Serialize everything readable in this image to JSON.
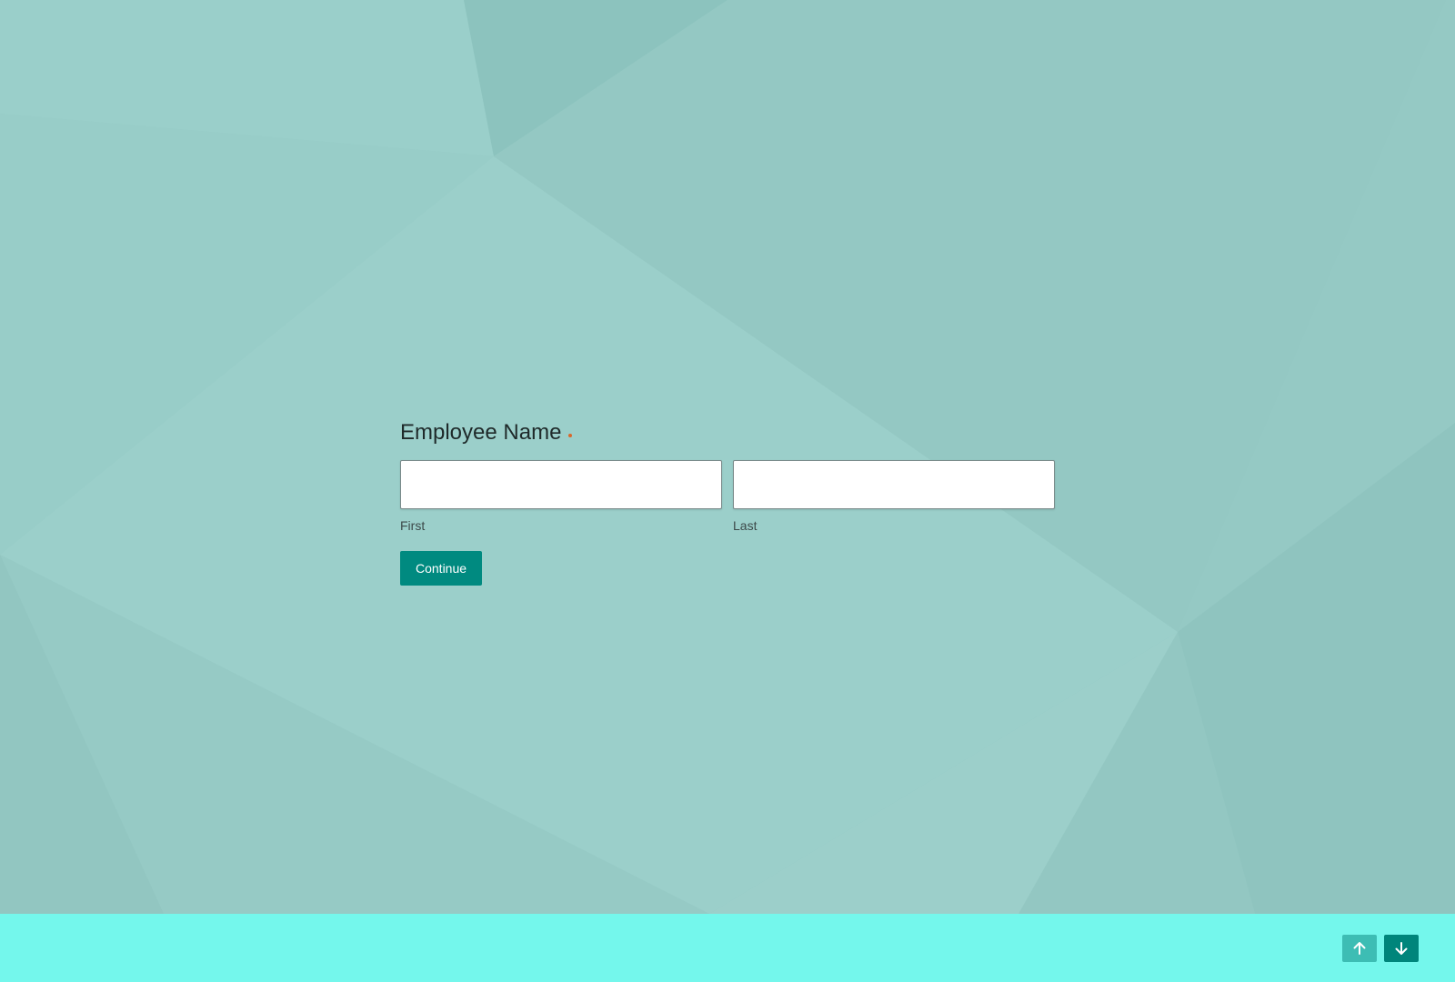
{
  "question": {
    "label": "Employee Name",
    "required": true
  },
  "fields": {
    "first": {
      "value": "",
      "sublabel": "First"
    },
    "last": {
      "value": "",
      "sublabel": "Last"
    }
  },
  "actions": {
    "continue_label": "Continue"
  },
  "footer_nav": {
    "up_icon": "arrow-up-icon",
    "down_icon": "arrow-down-icon"
  },
  "colors": {
    "background": "#96c9c4",
    "footer": "#74f7ec",
    "button": "#008a80",
    "nav_up": "#3dbdb4",
    "nav_down": "#00857b",
    "required_marker": "#d9682a"
  }
}
